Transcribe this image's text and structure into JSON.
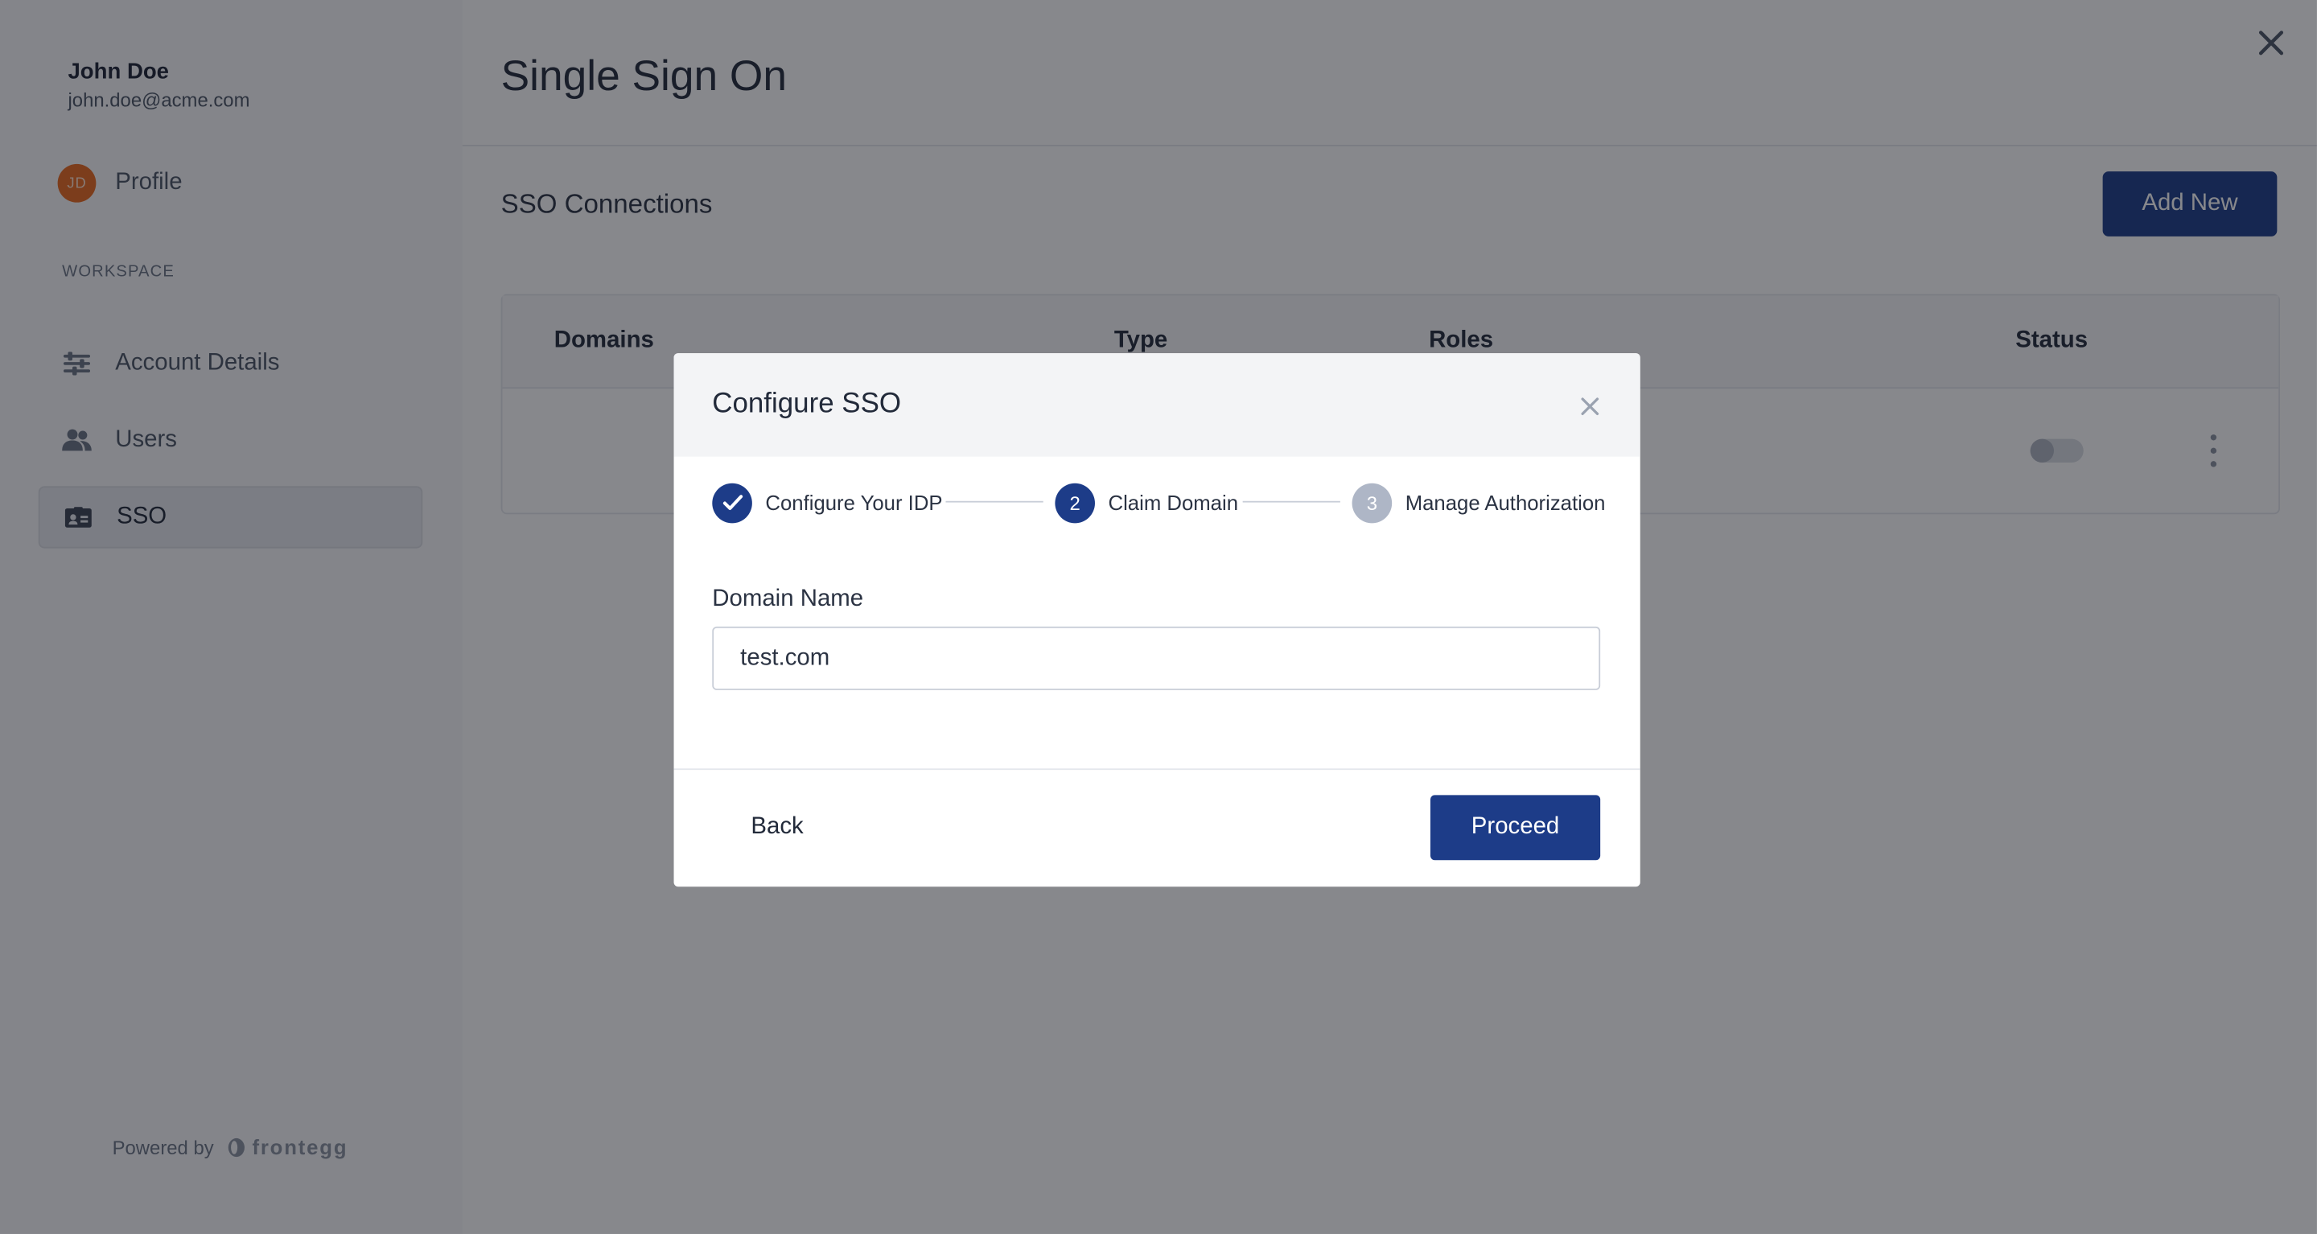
{
  "sidebar": {
    "user_name": "John Doe",
    "user_email": "john.doe@acme.com",
    "avatar_initials": "JD",
    "profile_label": "Profile",
    "section_label": "WORKSPACE",
    "items": [
      {
        "label": "Account Details",
        "icon": "sliders-icon"
      },
      {
        "label": "Users",
        "icon": "users-icon"
      },
      {
        "label": "SSO",
        "icon": "id-card-icon",
        "active": true
      }
    ],
    "powered_by": "Powered by",
    "brand": "frontegg"
  },
  "main": {
    "title": "Single Sign On",
    "section_title": "SSO Connections",
    "add_new_label": "Add New",
    "table": {
      "columns": [
        "Domains",
        "Type",
        "Roles",
        "Status"
      ],
      "rows": [
        {
          "status_enabled": false
        }
      ]
    }
  },
  "modal": {
    "title": "Configure SSO",
    "steps": [
      {
        "label": "Configure Your IDP",
        "state": "done",
        "number": ""
      },
      {
        "label": "Claim Domain",
        "state": "current",
        "number": "2"
      },
      {
        "label": "Manage Authorization",
        "state": "pending",
        "number": "3"
      }
    ],
    "field_label": "Domain Name",
    "field_value": "test.com",
    "back_label": "Back",
    "proceed_label": "Proceed"
  },
  "colors": {
    "primary": "#1d3c88",
    "avatar": "#e8691e",
    "step_pending": "#aeb6c6",
    "overlay": "rgba(15,18,25,0.50)"
  }
}
